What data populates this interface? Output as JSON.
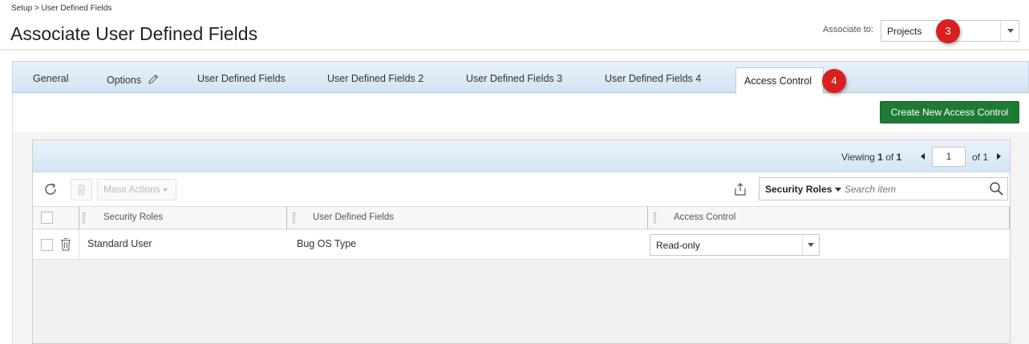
{
  "breadcrumb": "Setup > User Defined Fields",
  "page_title": "Associate User Defined Fields",
  "associate": {
    "label": "Associate to:",
    "value": "Projects"
  },
  "badges": {
    "associate": "3",
    "tab": "4"
  },
  "tabs": [
    {
      "label": "General"
    },
    {
      "label": "Options"
    },
    {
      "label": "User Defined Fields"
    },
    {
      "label": "User Defined Fields 2"
    },
    {
      "label": "User Defined Fields 3"
    },
    {
      "label": "User Defined Fields 4"
    },
    {
      "label": "Access Control",
      "active": true
    }
  ],
  "create_button": "Create New Access Control",
  "pager": {
    "viewing_prefix": "Viewing",
    "viewing_current": "1",
    "viewing_of": "of",
    "viewing_total": "1",
    "page": "1",
    "of_total": "of 1"
  },
  "toolbar": {
    "mass_actions": "Mass Actions",
    "search_filter": "Security Roles",
    "search_placeholder": "Search item"
  },
  "columns": [
    "Security Roles",
    "User Defined Fields",
    "Access Control"
  ],
  "rows": [
    {
      "security_role": "Standard User",
      "udf": "Bug OS Type",
      "access_control": "Read-only"
    }
  ],
  "colors": {
    "accent_green": "#1e7b35",
    "badge_red": "#d91f1f",
    "tab_bar_blue": "#d3e3f3"
  }
}
